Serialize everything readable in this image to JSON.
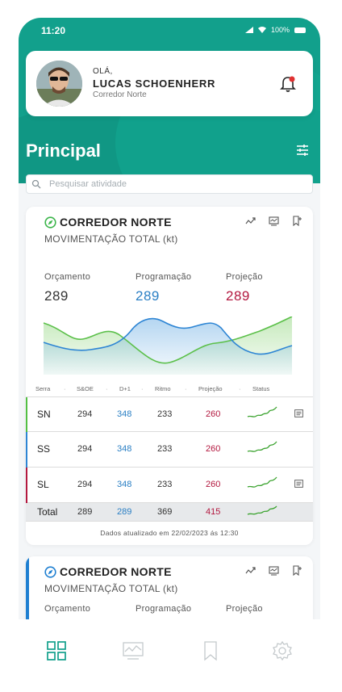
{
  "status": {
    "time": "11:20",
    "battery": "100%"
  },
  "profile": {
    "greeting": "OLÁ,",
    "name": "LUCAS SCHOENHERR",
    "role": "Corredor Norte"
  },
  "page_title": "Principal",
  "search": {
    "placeholder": "Pesquisar atividade"
  },
  "card": {
    "title": "CORREDOR NORTE",
    "subtitle": "MOVIMENTAÇÃO TOTAL (kt)",
    "metrics": [
      {
        "label": "Orçamento",
        "value": "289",
        "color": "#333333"
      },
      {
        "label": "Programação",
        "value": "289",
        "color": "#2a7fc4"
      },
      {
        "label": "Projeção",
        "value": "289",
        "color": "#b3183f"
      }
    ],
    "table": {
      "headers": [
        "Serra",
        "S&OE",
        "D+1",
        "Ritmo",
        "Projeção",
        "Status"
      ],
      "rows": [
        {
          "label": "SN",
          "soe": "294",
          "d1": "348",
          "ritmo": "233",
          "proj": "260",
          "bar_color": "#53c043",
          "comment": true
        },
        {
          "label": "SS",
          "soe": "294",
          "d1": "348",
          "ritmo": "233",
          "proj": "260",
          "bar_color": "#2d85d4",
          "comment": false
        },
        {
          "label": "SL",
          "soe": "294",
          "d1": "348",
          "ritmo": "233",
          "proj": "260",
          "bar_color": "#b3183f",
          "comment": true
        }
      ],
      "total": {
        "label": "Total",
        "soe": "289",
        "d1": "289",
        "ritmo": "369",
        "proj": "415"
      }
    },
    "updated": "Dados atualizado em 22/02/2023 ás 12:30"
  },
  "card2": {
    "title": "CORREDOR NORTE",
    "subtitle": "MOVIMENTAÇÃO TOTAL (kt)",
    "metric_labels": [
      "Orçamento",
      "Programação",
      "Projeção"
    ]
  },
  "tabbar": [
    "dashboard-icon",
    "activity-chart-icon",
    "bookmark-icon",
    "settings-icon"
  ],
  "colors": {
    "accent": "#12a08c",
    "green": "#53c043",
    "blue": "#2d85d4",
    "red": "#b3183f"
  }
}
